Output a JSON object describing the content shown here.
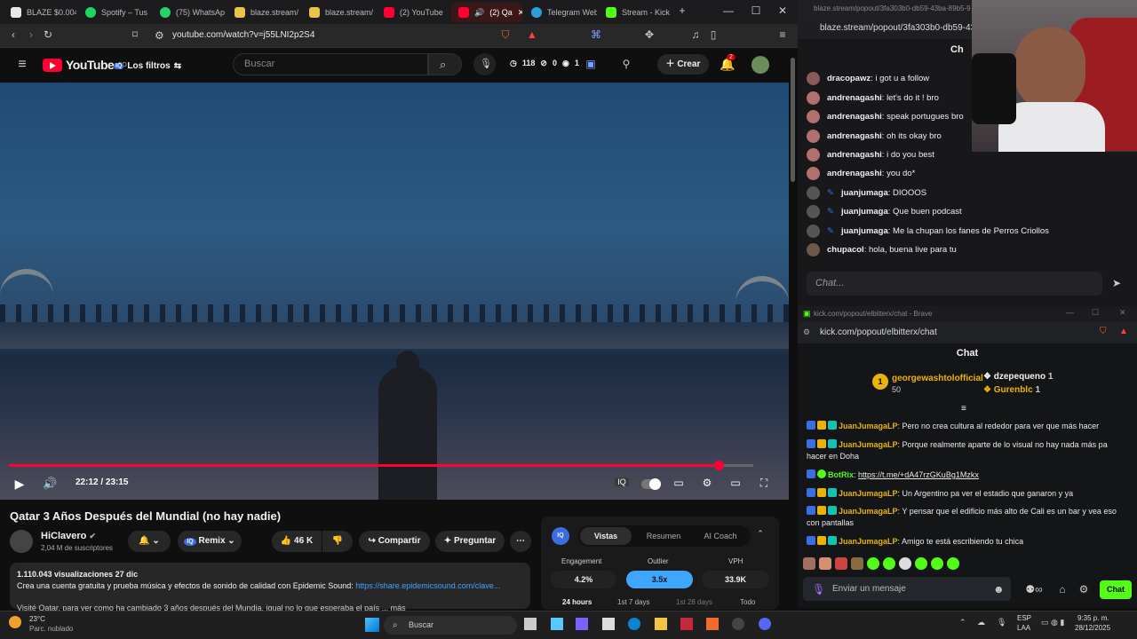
{
  "browser": {
    "tabs": [
      {
        "label": "BLAZE $0.004",
        "color": "#e8e8e8"
      },
      {
        "label": "Spotify – Tus",
        "color": "#1ed760"
      },
      {
        "label": "(75) WhatsAp",
        "color": "#25d366"
      },
      {
        "label": "blaze.stream/",
        "color": "#e8c547"
      },
      {
        "label": "blaze.stream/",
        "color": "#e8c547"
      },
      {
        "label": "(2) YouTube",
        "color": "#ff0033"
      },
      {
        "label": "(2) Qa",
        "color": "#ff0033"
      },
      {
        "label": "Telegram Web",
        "color": "#2aa1df"
      },
      {
        "label": "Stream - Kick",
        "color": "#53fc18"
      }
    ],
    "url": "youtube.com/watch?v=j55LNI2p2S4",
    "shield_badge": "1"
  },
  "youtube": {
    "logo": "YouTube",
    "logo_region": "CO",
    "filters": "Los filtros",
    "search_placeholder": "Buscar",
    "stats": {
      "views": "118",
      "a": "0",
      "b": "1"
    },
    "create": "Crear",
    "notif_count": "2",
    "video": {
      "time": "22:12 / 23:15",
      "progress": 0.954,
      "title": "Qatar 3 Años Después del Mundial (no hay nadie)",
      "channel": "HiClavero",
      "subs": "2,04 M de suscriptores",
      "remix": "Remix",
      "likes": "46 K",
      "share": "Compartir",
      "ask": "Preguntar",
      "desc_stats": "1.110.043 visualizaciones  27 dic",
      "desc_line": "Crea una cuenta gratuita y prueba música y efectos de sonido de calidad con Epidemic Sound: ",
      "desc_link": "https://share.epidemicsound.com/clave...",
      "desc_line2": "Visité Qatar, para ver como ha cambiado 3 años después del Mundia, igual no lo que esperaba el país ... más"
    },
    "panel": {
      "tabs": [
        "Vistas",
        "Resumen",
        "AI Coach"
      ],
      "metrics": [
        {
          "label": "Engagement",
          "value": "4.2%"
        },
        {
          "label": "Outlier",
          "value": "3.5x"
        },
        {
          "label": "VPH",
          "value": "33.9K"
        }
      ],
      "ranges": [
        "24 hours",
        "1st 7 days",
        "1st 28 days",
        "Todo"
      ]
    }
  },
  "twitch_chat": {
    "url": "blaze.stream/popout/3fa303b0-db59-43ba-89b5-9",
    "header": "Ch",
    "messages": [
      {
        "user": "dracopawz",
        "text": "i got u a follow"
      },
      {
        "user": "andrenagashi",
        "text": "let's do it ! bro"
      },
      {
        "user": "andrenagashi",
        "text": "speak portugues bro"
      },
      {
        "user": "andrenagashi",
        "text": "oh its okay bro"
      },
      {
        "user": "andrenagashi",
        "text": "i do you best"
      },
      {
        "user": "andrenagashi",
        "text": "you do*"
      },
      {
        "user": "juanjumaga",
        "text": "DIOOOS"
      },
      {
        "user": "juanjumaga",
        "text": "Que buen podcast"
      },
      {
        "user": "juanjumaga",
        "text": "Me la chupan los fanes de Perros Criollos"
      },
      {
        "user": "chupacol",
        "text": "hola, buena live para tu"
      }
    ],
    "placeholder": "Chat..."
  },
  "kick_chat": {
    "window_title": "kick.com/popout/elbitterx/chat - Brave",
    "url": "kick.com/popout/elbitterx/chat",
    "header": "Chat",
    "leaders": [
      {
        "rank": "1",
        "name": "georgewashtolofficial",
        "amount": "50"
      },
      {
        "name": "dzepequeno",
        "amount": "1"
      },
      {
        "name": "Gurenblc",
        "amount": "1"
      }
    ],
    "messages": [
      {
        "user": "JuanJumagaLP",
        "text": "Pero no crea cultura al rededor para ver que más hacer"
      },
      {
        "user": "JuanJumagaLP",
        "text": "Porque realmente aparte de lo visual no hay nada más pa hacer en Doha"
      },
      {
        "user": "BotRix",
        "text": "https://t.me/+dA47rzGKuBg1Mzkx"
      },
      {
        "user": "JuanJumagaLP",
        "text": "Un Argentino pa ver el estadio que ganaron y ya"
      },
      {
        "user": "JuanJumagaLP",
        "text": "Y pensar que el edificio más alto de Cali es un bar y vea eso con pantallas"
      },
      {
        "user": "JuanJumagaLP",
        "text": "Amigo te está escribiendo tu chica"
      }
    ],
    "placeholder": "Enviar un mensaje",
    "send": "Chat"
  },
  "taskbar": {
    "weather_temp": "23°C",
    "weather_desc": "Parc. nublado",
    "search": "Buscar",
    "lang1": "ESP",
    "lang2": "LAA",
    "time": "9:35 p. m.",
    "date": "28/12/2025"
  }
}
